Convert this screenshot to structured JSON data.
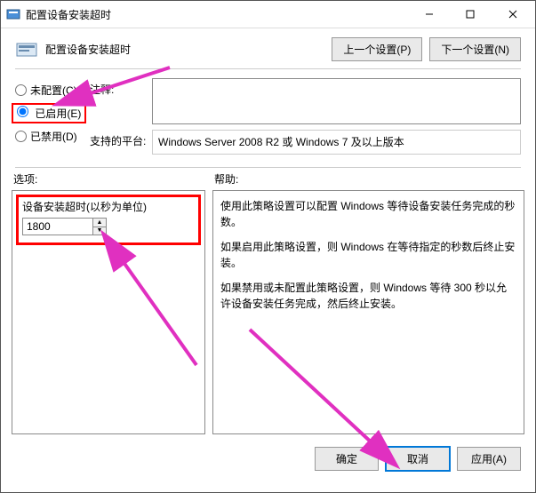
{
  "window": {
    "title": "配置设备安装超时"
  },
  "header": {
    "title": "配置设备安装超时",
    "prev_label": "上一个设置(P)",
    "next_label": "下一个设置(N)"
  },
  "radios": {
    "not_configured": "未配置(C)",
    "enabled": "已启用(E)",
    "disabled": "已禁用(D)",
    "selected": "enabled"
  },
  "labels": {
    "comment": "注释:",
    "platform": "支持的平台:",
    "options": "选项:",
    "help": "帮助:"
  },
  "comment_value": "",
  "platform_text": "Windows Server 2008 R2 或 Windows 7 及以上版本",
  "option": {
    "label": "设备安装超时(以秒为单位)",
    "value": "1800"
  },
  "help_paragraphs": [
    "使用此策略设置可以配置 Windows 等待设备安装任务完成的秒数。",
    "如果启用此策略设置，则 Windows 在等待指定的秒数后终止安装。",
    "如果禁用或未配置此策略设置，则 Windows 等待 300 秒以允许设备安装任务完成，然后终止安装。"
  ],
  "footer": {
    "ok": "确定",
    "cancel": "取消",
    "apply": "应用(A)"
  }
}
